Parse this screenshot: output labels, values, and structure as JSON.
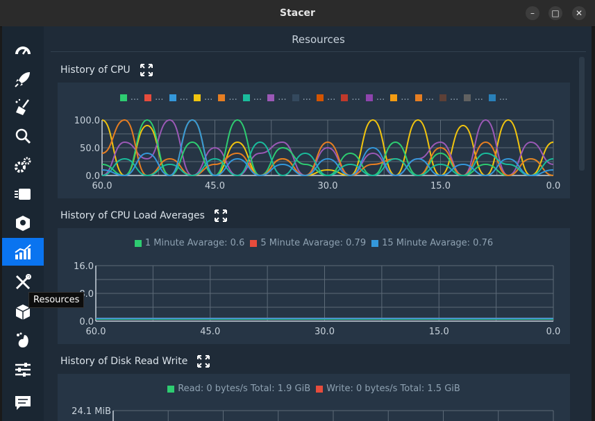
{
  "window": {
    "title": "Stacer",
    "minimize": "–",
    "maximize": "□",
    "close": "✕"
  },
  "sidebar": {
    "items": [
      {
        "icon": "dashboard-icon"
      },
      {
        "icon": "rocket-icon"
      },
      {
        "icon": "broom-icon"
      },
      {
        "icon": "search-icon"
      },
      {
        "icon": "gears-icon"
      },
      {
        "icon": "processes-icon"
      },
      {
        "icon": "uninstaller-icon"
      },
      {
        "icon": "resources-icon",
        "active": true
      },
      {
        "icon": "tools-icon"
      },
      {
        "icon": "package-icon"
      },
      {
        "icon": "gnome-icon"
      },
      {
        "icon": "settings-sliders-icon"
      },
      {
        "icon": "feedback-icon"
      }
    ],
    "tooltip": "Resources"
  },
  "page": {
    "title": "Resources"
  },
  "colors": {
    "accent": "#0a74f0"
  },
  "cpu": {
    "title": "History of CPU",
    "legend": [
      {
        "label": "...",
        "color": "#2ecc71"
      },
      {
        "label": "...",
        "color": "#e74c3c"
      },
      {
        "label": "...",
        "color": "#3498db"
      },
      {
        "label": "...",
        "color": "#f1c40f"
      },
      {
        "label": "...",
        "color": "#e67e22"
      },
      {
        "label": "...",
        "color": "#1abc9c"
      },
      {
        "label": "...",
        "color": "#9b59b6"
      },
      {
        "label": "...",
        "color": "#34495e"
      },
      {
        "label": "...",
        "color": "#d35400"
      },
      {
        "label": "...",
        "color": "#c0392b"
      },
      {
        "label": "...",
        "color": "#8e44ad"
      },
      {
        "label": "...",
        "color": "#f39c12"
      },
      {
        "label": "...",
        "color": "#e67e22"
      },
      {
        "label": "...",
        "color": "#5d4037"
      },
      {
        "label": "...",
        "color": "#616161"
      },
      {
        "label": "...",
        "color": "#2980b9"
      }
    ]
  },
  "load": {
    "title": "History of CPU Load Averages",
    "legend": [
      {
        "label": "1 Minute Avarage: 0.6",
        "color": "#2ecc71"
      },
      {
        "label": "5 Minute Avarage: 0.79",
        "color": "#e74c3c"
      },
      {
        "label": "15 Minute Avarage: 0.76",
        "color": "#3498db"
      }
    ]
  },
  "disk": {
    "title": "History of Disk Read Write",
    "legend": [
      {
        "label": "Read: 0 bytes/s Total: 1.9 GiB",
        "color": "#2ecc71"
      },
      {
        "label": "Write: 0 bytes/s Total: 1.5 GiB",
        "color": "#e74c3c"
      }
    ]
  },
  "chart_data": [
    {
      "type": "line",
      "title": "History of CPU",
      "x": [
        60,
        57,
        54,
        51,
        48,
        45,
        42,
        39,
        36,
        33,
        30,
        27,
        24,
        21,
        18,
        15,
        12,
        9,
        6,
        3,
        0
      ],
      "xticks": [
        "60.0",
        "45.0",
        "30.0",
        "15.0",
        "0.0"
      ],
      "yticks": [
        "0.0",
        "50.0",
        "100.0"
      ],
      "ylim": [
        0,
        100
      ],
      "series": [
        {
          "values": [
            100,
            0,
            90,
            0,
            100,
            0,
            60,
            0,
            30,
            0,
            10,
            0,
            100,
            0,
            100,
            0,
            90,
            0,
            100,
            0,
            60
          ]
        },
        {
          "values": [
            0,
            60,
            30,
            100,
            0,
            50,
            0,
            40,
            60,
            0,
            50,
            0,
            40,
            0,
            30,
            60,
            0,
            100,
            0,
            60,
            20
          ]
        },
        {
          "values": [
            20,
            0,
            100,
            0,
            60,
            0,
            100,
            0,
            50,
            20,
            0,
            40,
            0,
            60,
            0,
            40,
            0,
            20,
            0,
            30,
            0
          ]
        },
        {
          "values": [
            40,
            100,
            0,
            30,
            0,
            20,
            40,
            0,
            30,
            0,
            60,
            0,
            20,
            30,
            0,
            50,
            0,
            60,
            0,
            30,
            0
          ]
        },
        {
          "values": [
            0,
            30,
            0,
            20,
            0,
            30,
            0,
            60,
            0,
            40,
            0,
            20,
            0,
            30,
            0,
            20,
            0,
            40,
            20,
            0,
            30
          ]
        },
        {
          "values": [
            10,
            0,
            40,
            0,
            100,
            0,
            30,
            0,
            20,
            0,
            30,
            0,
            50,
            0,
            30,
            0,
            20,
            0,
            30,
            0,
            10
          ]
        }
      ],
      "grid": true
    },
    {
      "type": "line",
      "title": "History of CPU Load Averages",
      "x": [
        60,
        45,
        30,
        15,
        0
      ],
      "xticks": [
        "60.0",
        "45.0",
        "30.0",
        "15.0",
        "0.0"
      ],
      "yticks": [
        "0.0",
        "8.0",
        "16.0"
      ],
      "ylim": [
        0,
        16
      ],
      "series": [
        {
          "values": [
            0.6,
            0.6,
            0.6,
            0.6,
            0.6
          ]
        },
        {
          "values": [
            0.79,
            0.79,
            0.79,
            0.79,
            0.79
          ]
        },
        {
          "values": [
            0.76,
            0.76,
            0.76,
            0.76,
            0.76
          ]
        }
      ],
      "grid": true
    },
    {
      "type": "line",
      "title": "History of Disk Read Write",
      "yticks": [
        "24.1 MiB"
      ],
      "grid": true
    }
  ]
}
